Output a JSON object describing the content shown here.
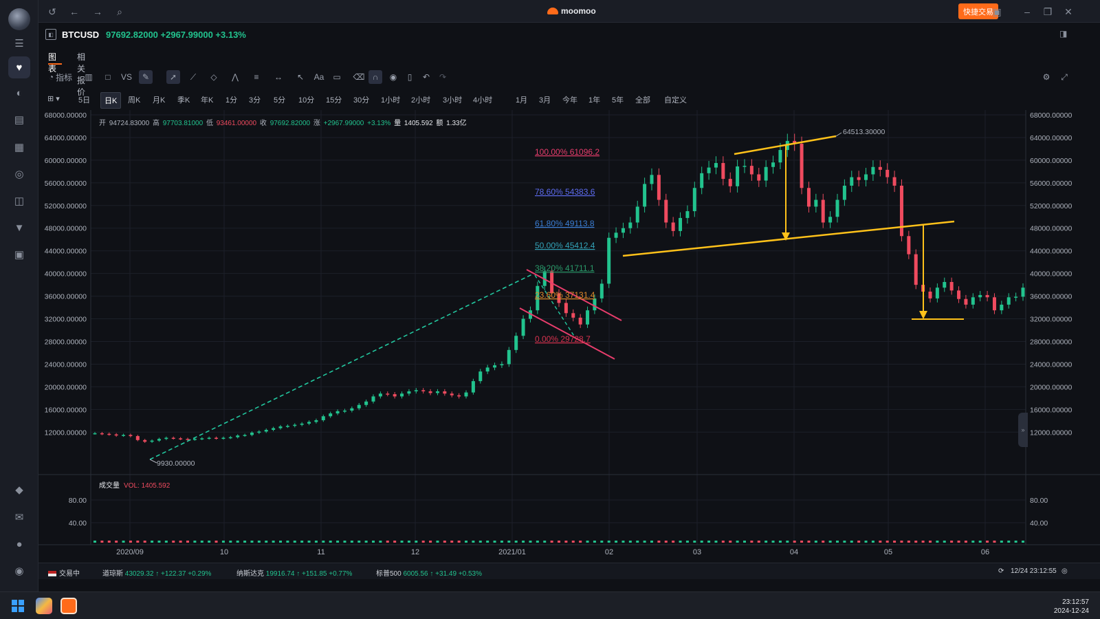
{
  "titlebar": {
    "app_name": "moomoo",
    "quick_trade_label": "快捷交易"
  },
  "quote": {
    "symbol": "BTCUSD",
    "price_line": "97692.82000 +2967.99000 +3.13%"
  },
  "tabs": [
    "图表",
    "相关报价"
  ],
  "toolbar": {
    "indicator_label": "指标",
    "vs_label": "VS",
    "text_tool_label": "Aa"
  },
  "periods": [
    "5日",
    "日K",
    "周K",
    "月K",
    "季K",
    "年K",
    "1分",
    "3分",
    "5分",
    "10分",
    "15分",
    "30分",
    "1小时",
    "2小时",
    "3小时",
    "4小时",
    "1月",
    "3月",
    "今年",
    "1年",
    "5年",
    "全部",
    "自定义"
  ],
  "periods_active": "日K",
  "ohlc": {
    "open_label": "开",
    "open": "94724.83000",
    "high_label": "高",
    "high": "97703.81000",
    "low_label": "低",
    "low": "93461.00000",
    "close_label": "收",
    "close": "97692.82000",
    "change_label": "涨",
    "change": "+2967.99000",
    "change_pct": "+3.13%",
    "volume_label": "量",
    "volume": "1405.592",
    "amount_label": "额",
    "amount": "1.33亿"
  },
  "volume_panel": {
    "label": "成交量",
    "value": "VOL: 1405.592"
  },
  "chart_data": {
    "type": "candlestick",
    "y_ticks": [
      "68000.00000",
      "64000.00000",
      "60000.00000",
      "56000.00000",
      "52000.00000",
      "48000.00000",
      "44000.00000",
      "40000.00000",
      "36000.00000",
      "32000.00000",
      "28000.00000",
      "24000.00000",
      "20000.00000",
      "16000.00000",
      "12000.00000"
    ],
    "ylim": [
      9000,
      68000
    ],
    "volume_ticks": [
      "80.00",
      "40.00"
    ],
    "x_ticks": [
      "2020/09",
      "10",
      "11",
      "12",
      "2021/01",
      "02",
      "03",
      "04",
      "05",
      "06"
    ],
    "markers": {
      "low": "9930.00000",
      "high": "64513.30000"
    },
    "fib_levels": [
      {
        "label": "100.00% 61096.2",
        "color": "#e83d6c"
      },
      {
        "label": "78.60% 54383.6",
        "color": "#5d6cf0"
      },
      {
        "label": "61.80% 49113.8",
        "color": "#3b7fd6"
      },
      {
        "label": "50.00% 45412.4",
        "color": "#33a3b8"
      },
      {
        "label": "38.20% 41711.1",
        "color": "#2a9a6a"
      },
      {
        "label": "23.60% 37131.4",
        "color": "#e08a2a"
      },
      {
        "label": "0.00% 29728.7",
        "color": "#d8324f"
      }
    ],
    "closes": [
      11800,
      11700,
      11600,
      11400,
      11500,
      11300,
      10600,
      10300,
      10500,
      10800,
      11000,
      10900,
      10800,
      10700,
      10800,
      10900,
      11000,
      10900,
      11000,
      11100,
      11400,
      11500,
      11900,
      12100,
      12400,
      12700,
      13000,
      13100,
      13300,
      13500,
      13800,
      14100,
      14800,
      15300,
      15700,
      15800,
      16200,
      16800,
      17400,
      18300,
      18800,
      18700,
      18300,
      18800,
      19200,
      19400,
      19200,
      18900,
      19200,
      18800,
      18500,
      18300,
      19000,
      21000,
      22700,
      23400,
      23800,
      24000,
      26500,
      29000,
      32000,
      33500,
      37800,
      40400,
      36500,
      34800,
      33000,
      32200,
      31000,
      33500,
      35600,
      38200,
      46300,
      47200,
      48000,
      49000,
      51800,
      55800,
      57400,
      53000,
      49000,
      47500,
      49800,
      51000,
      55100,
      57700,
      58700,
      59500,
      56700,
      55400,
      58900,
      59000,
      57500,
      56400,
      58800,
      59600,
      61800,
      63400,
      62900,
      55100,
      51800,
      53000,
      49000,
      50000,
      53000,
      55500,
      57000,
      56500,
      57500,
      58800,
      58300,
      57000,
      55500,
      46600,
      43400,
      38000,
      36800,
      35600,
      37500,
      38500,
      37000,
      35500,
      34500,
      35800,
      36200,
      35800,
      33500,
      34500,
      35800,
      35900,
      37500
    ]
  },
  "status": {
    "market_state": "交易中",
    "dow_label": "道琼斯",
    "dow": "43029.32 ↑ +122.37 +0.29%",
    "nasdaq_label": "纳斯达克",
    "nasdaq": "19916.74 ↑ +151.85 +0.77%",
    "sp_label": "标普500",
    "sp": "6005.56 ↑ +31.49 +0.53%",
    "datetime": "12/24 23:12:55"
  },
  "taskbar": {
    "time": "23:12:57",
    "date": "2024-12-24"
  }
}
